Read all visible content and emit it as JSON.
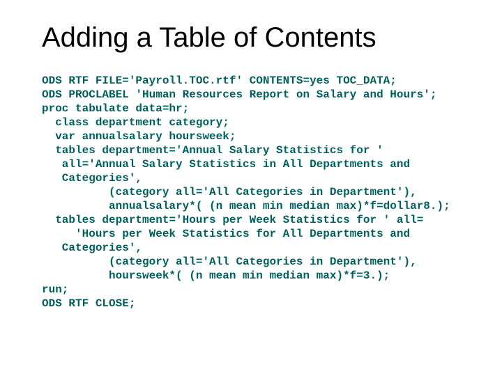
{
  "slide": {
    "title": "Adding a Table of Contents",
    "code": "ODS RTF FILE='Payroll.TOC.rtf' CONTENTS=yes TOC_DATA;\nODS PROCLABEL 'Human Resources Report on Salary and Hours';\nproc tabulate data=hr;\n  class department category;\n  var annualsalary hoursweek;\n  tables department='Annual Salary Statistics for '\n   all='Annual Salary Statistics in All Departments and\n   Categories',\n          (category all='All Categories in Department'),\n          annualsalary*( (n mean min median max)*f=dollar8.);\n  tables department='Hours per Week Statistics for ' all=\n     'Hours per Week Statistics for All Departments and\n   Categories',\n          (category all='All Categories in Department'),\n          hoursweek*( (n mean min median max)*f=3.);\nrun;\nODS RTF CLOSE;"
  }
}
